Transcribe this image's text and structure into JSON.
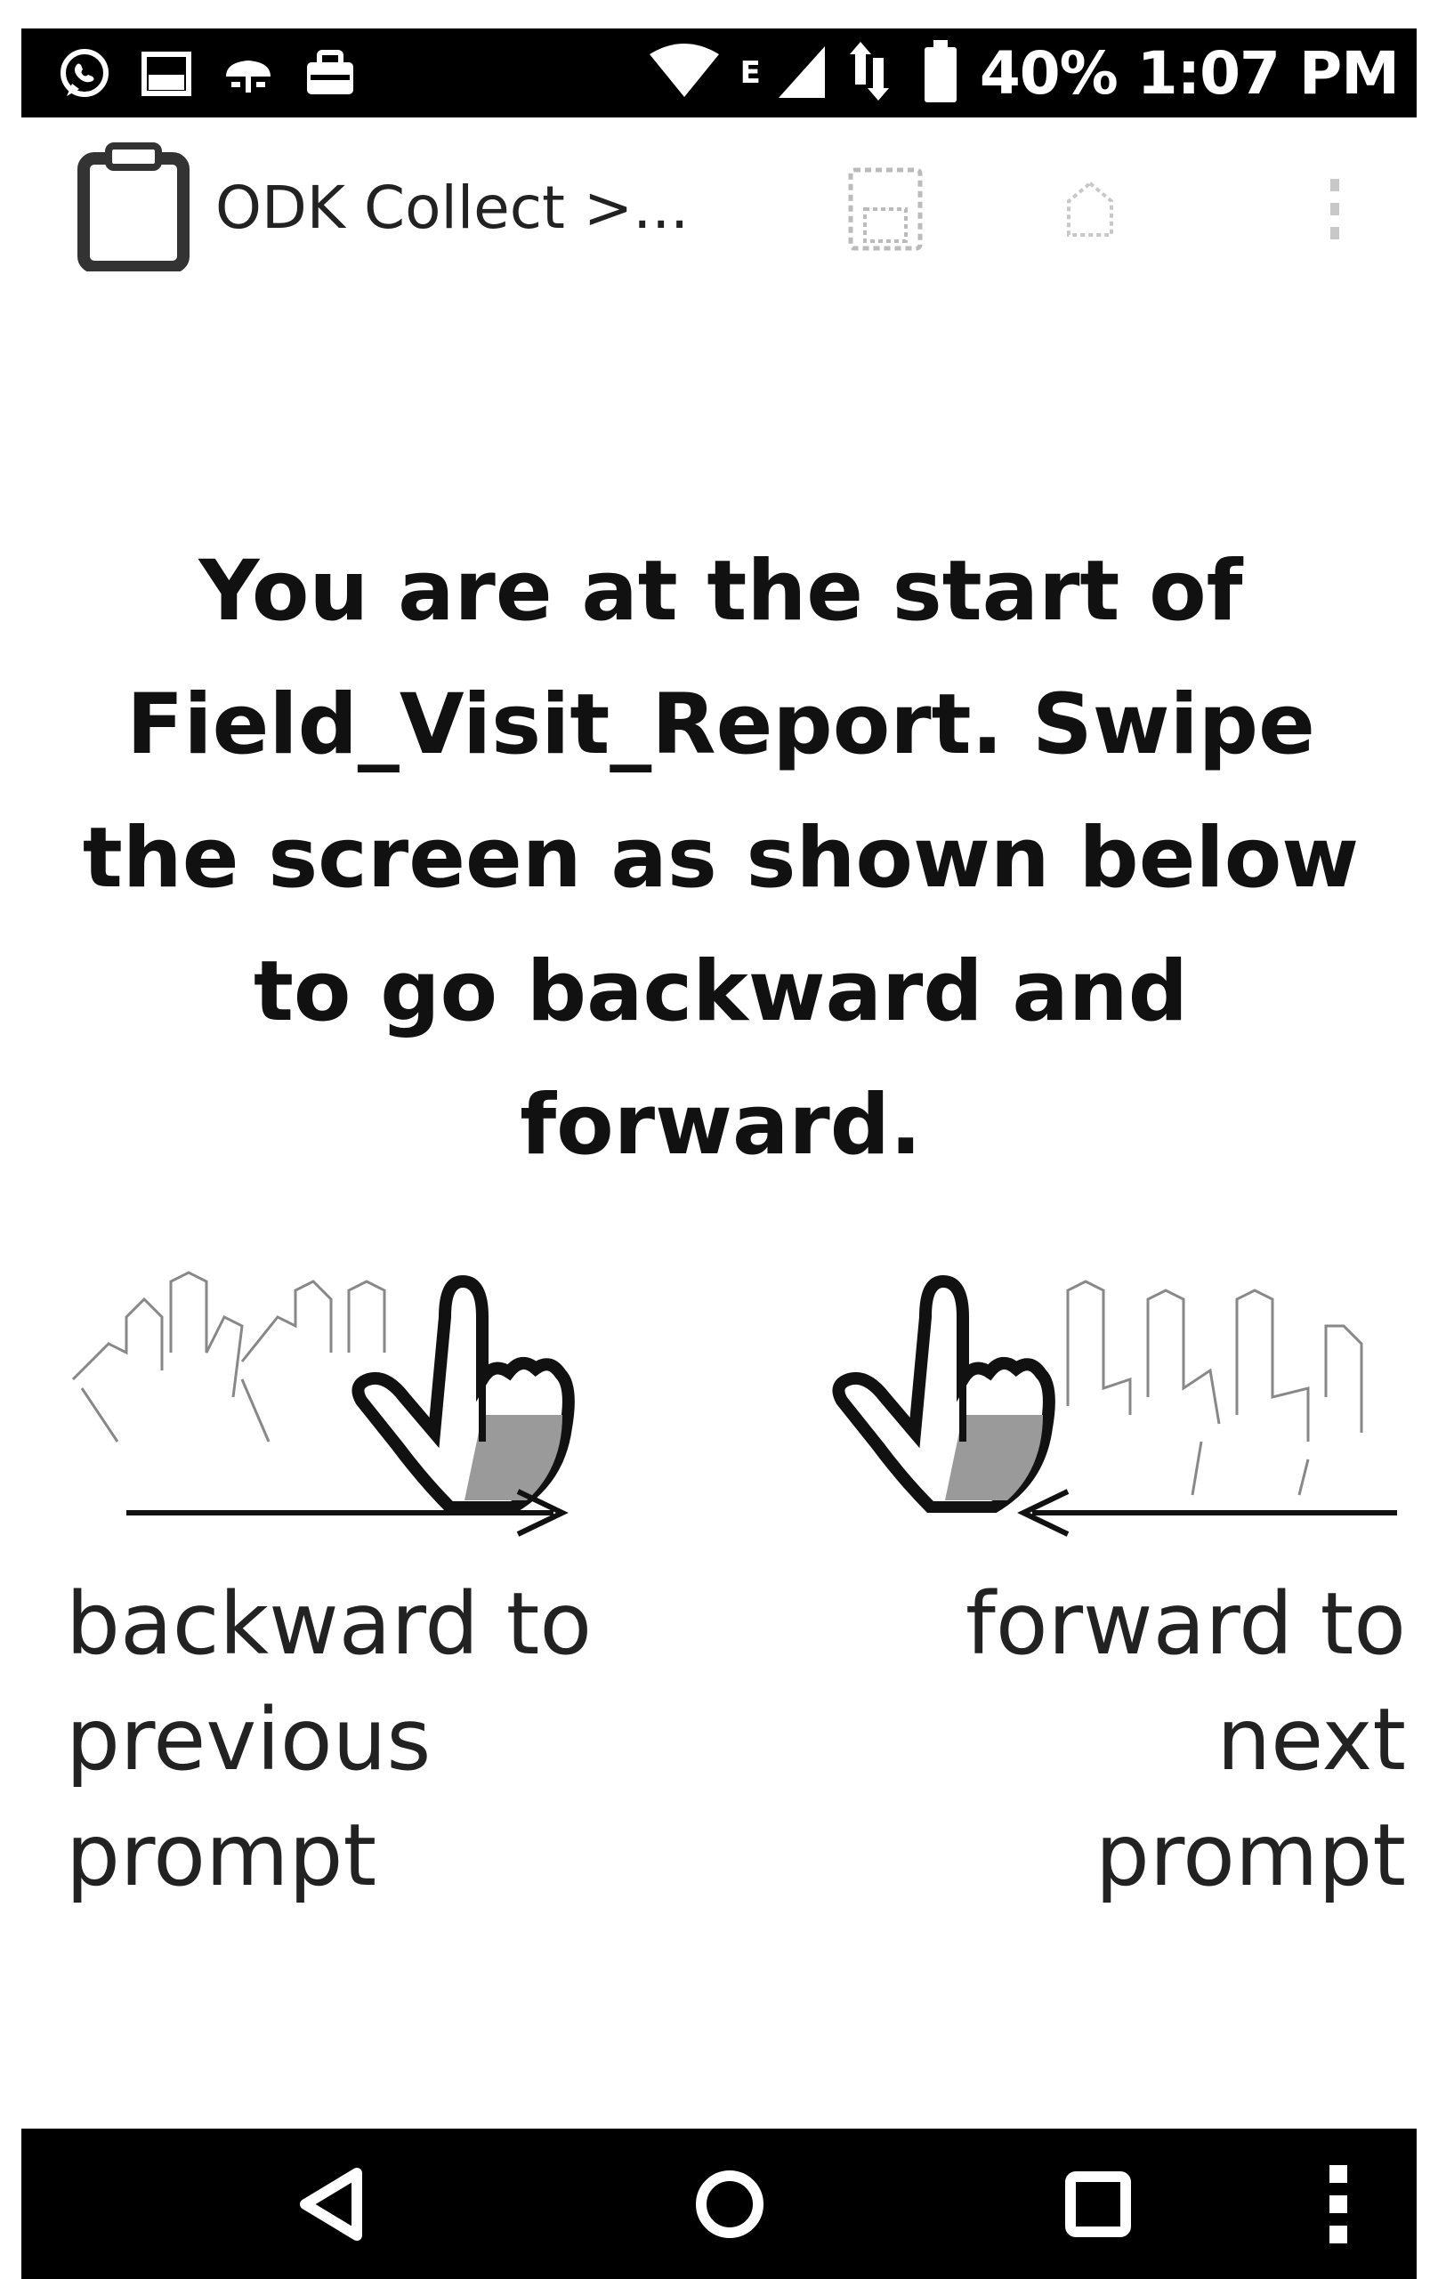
{
  "status_bar": {
    "icons": [
      "whatsapp-icon",
      "image-icon",
      "cloud-icon",
      "briefcase-icon",
      "wifi-icon",
      "signal-icon",
      "data-sync-icon",
      "battery-icon"
    ],
    "network_label": "E",
    "battery": "40%",
    "time": "1:07 PM"
  },
  "action_bar": {
    "title": "ODK Collect >...",
    "actions": [
      "save-icon",
      "hierarchy-icon",
      "overflow-menu-icon"
    ]
  },
  "message": {
    "lines": [
      "You are at the start of",
      "Field_Visit_Report. Swipe",
      "the screen as shown below",
      "to go backward and",
      "forward."
    ]
  },
  "gestures": {
    "backward": {
      "label_lines": [
        "backward to",
        "previous",
        "prompt"
      ]
    },
    "forward": {
      "label_lines": [
        "forward to",
        "next",
        "prompt"
      ]
    }
  },
  "nav_bar": {
    "buttons": [
      "back-icon",
      "home-icon",
      "recents-icon",
      "menu-icon"
    ]
  }
}
